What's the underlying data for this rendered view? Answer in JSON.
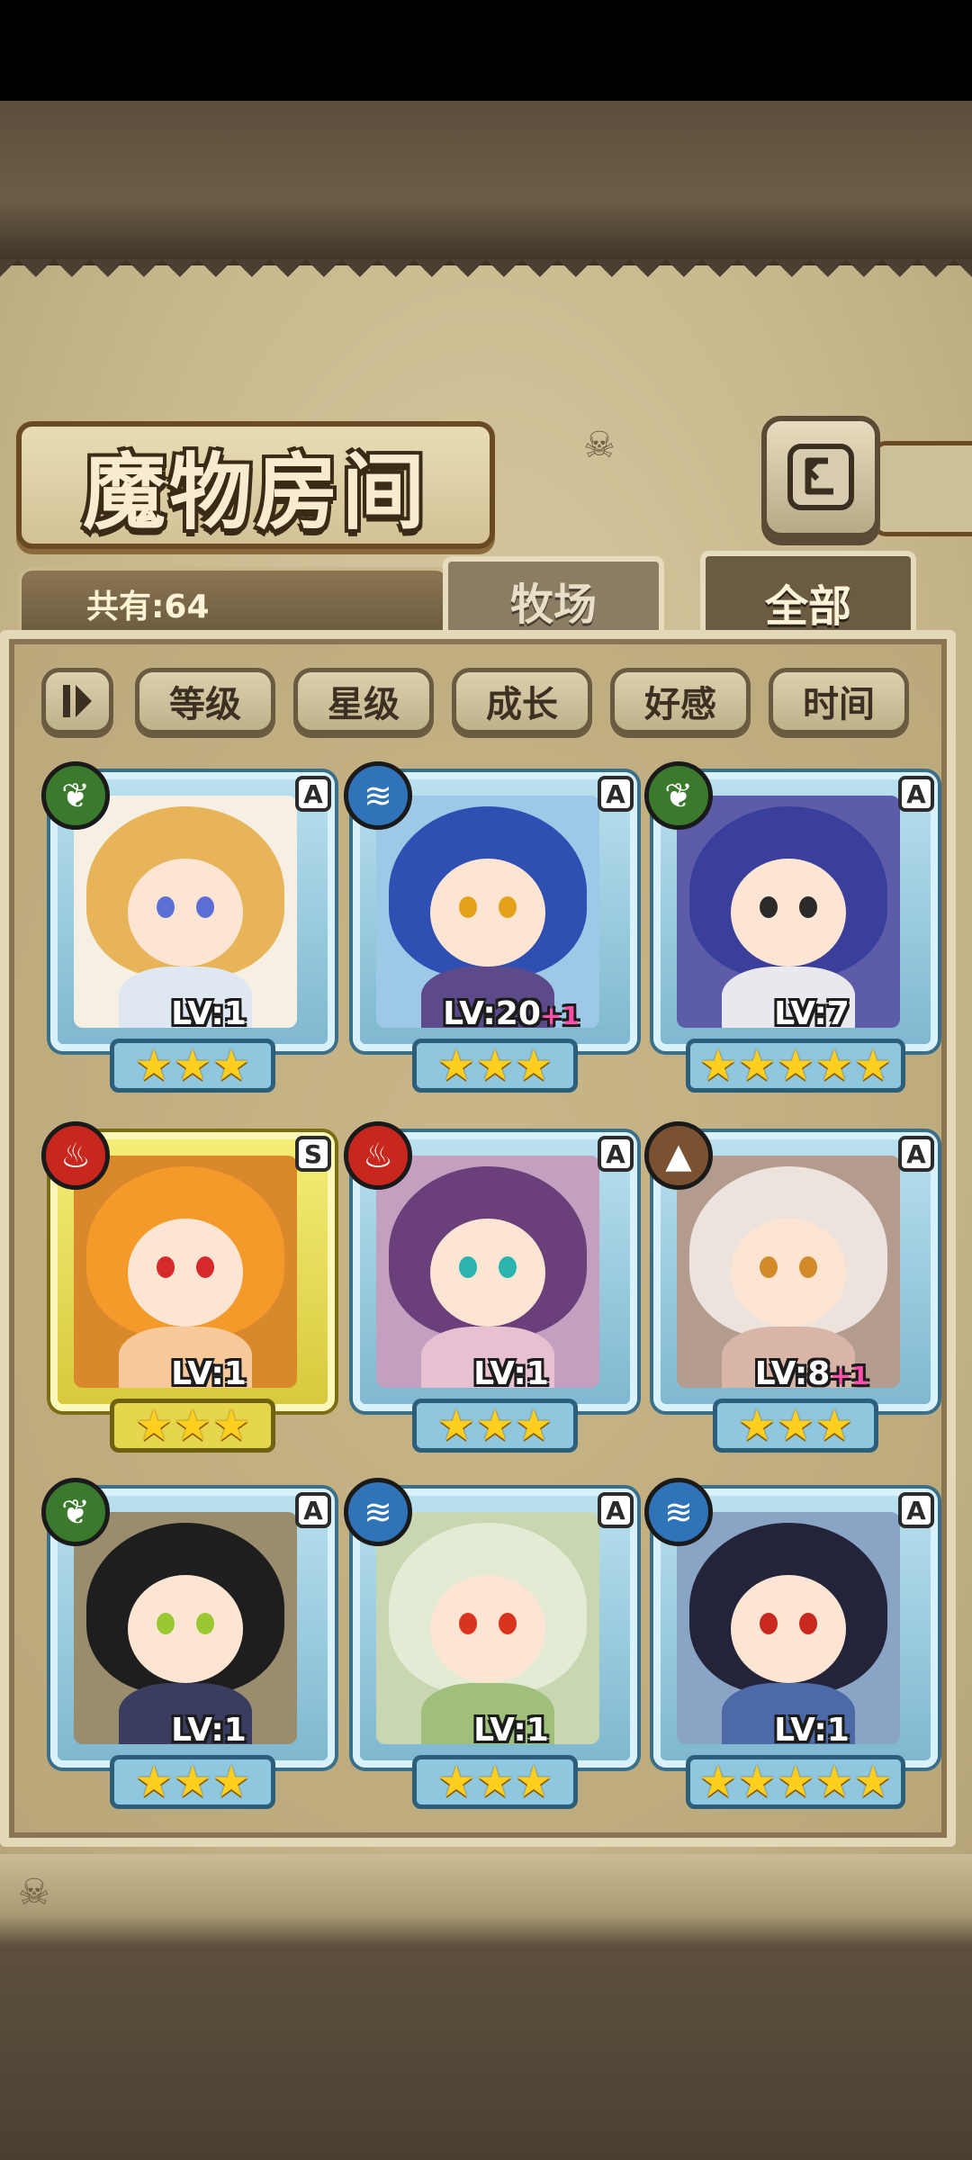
{
  "title": "魔物房间",
  "count_label": "共有:64",
  "tabs": {
    "ranch": "牧场",
    "all": "全部"
  },
  "sort": {
    "toggle_icon": "pause-like-toggle",
    "buttons": [
      "等级",
      "星级",
      "成长",
      "好感",
      "时间"
    ]
  },
  "back_icon": "return-arrow-icon",
  "monsters": [
    {
      "element": "wood",
      "element_icon": "leaf-icon",
      "rank": "A",
      "level": "LV:1",
      "bonus": "",
      "stars": 3
    },
    {
      "element": "water",
      "element_icon": "wave-icon",
      "rank": "A",
      "level": "LV:20",
      "bonus": "+1",
      "stars": 3
    },
    {
      "element": "wood",
      "element_icon": "leaf-icon",
      "rank": "A",
      "level": "LV:7",
      "bonus": "",
      "stars": 5
    },
    {
      "element": "fire",
      "element_icon": "flame-icon",
      "rank": "S",
      "level": "LV:1",
      "bonus": "",
      "stars": 3
    },
    {
      "element": "fire",
      "element_icon": "flame-icon",
      "rank": "A",
      "level": "LV:1",
      "bonus": "",
      "stars": 3
    },
    {
      "element": "earth",
      "element_icon": "mountain-icon",
      "rank": "A",
      "level": "LV:8",
      "bonus": "+1",
      "stars": 3
    },
    {
      "element": "wood",
      "element_icon": "leaf-icon",
      "rank": "A",
      "level": "LV:1",
      "bonus": "",
      "stars": 3
    },
    {
      "element": "water",
      "element_icon": "wave-icon",
      "rank": "A",
      "level": "LV:1",
      "bonus": "",
      "stars": 3
    },
    {
      "element": "water",
      "element_icon": "wave-icon",
      "rank": "A",
      "level": "LV:1",
      "bonus": "",
      "stars": 5
    }
  ],
  "colors": {
    "frame_A": "#b9e0ee",
    "frame_S": "#f3ee76",
    "star": "#ffcf1f",
    "bonus": "#ff4fa8"
  }
}
